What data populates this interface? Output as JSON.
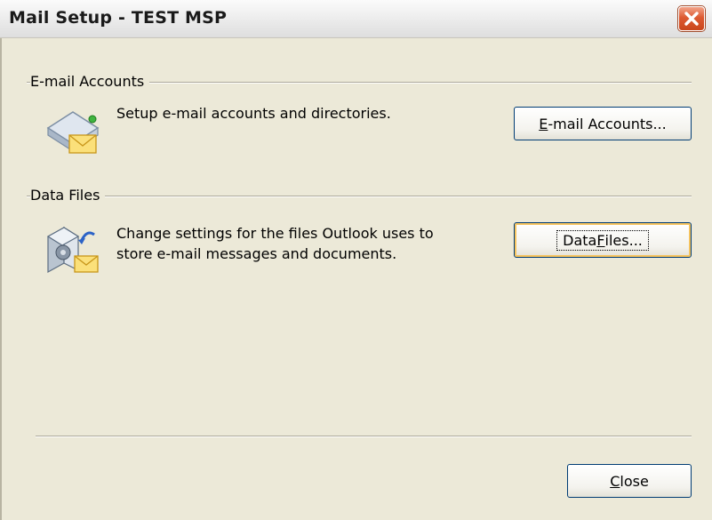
{
  "window": {
    "title": "Mail Setup - TEST MSP"
  },
  "email_accounts": {
    "section_title": "E-mail Accounts",
    "description": "Setup e-mail accounts and directories.",
    "button": {
      "mnemonic": "E",
      "rest": "-mail Accounts..."
    }
  },
  "data_files": {
    "section_title": "Data Files",
    "description_line1": "Change settings for the files Outlook uses to",
    "description_line2": "store e-mail messages and documents.",
    "button": {
      "before": "Data ",
      "mnemonic": "F",
      "after": "iles..."
    }
  },
  "footer": {
    "close_button": {
      "mnemonic": "C",
      "rest": "lose"
    }
  },
  "icons": {
    "email_accounts": "mail-accounts-icon",
    "data_files": "data-files-icon",
    "close": "close-icon"
  }
}
